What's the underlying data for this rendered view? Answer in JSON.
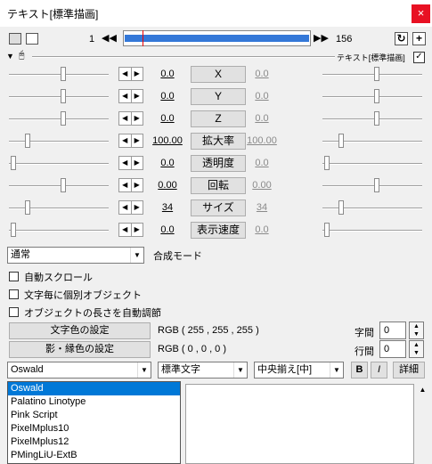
{
  "window": {
    "title": "テキスト[標準描画]",
    "close": "×"
  },
  "toolbar": {
    "frame_start": "1",
    "frame_end": "156",
    "prev_symbol": "◀◀",
    "next_symbol": "▶▶",
    "plus": "+"
  },
  "layer_header": {
    "object_name": "テキスト[標準描画]"
  },
  "params": [
    {
      "label": "X",
      "value": "0.0",
      "end_value": "0.0"
    },
    {
      "label": "Y",
      "value": "0.0",
      "end_value": "0.0"
    },
    {
      "label": "Z",
      "value": "0.0",
      "end_value": "0.0"
    },
    {
      "label": "拡大率",
      "value": "100.00",
      "end_value": "100.00"
    },
    {
      "label": "透明度",
      "value": "0.0",
      "end_value": "0.0"
    },
    {
      "label": "回転",
      "value": "0.00",
      "end_value": "0.00"
    },
    {
      "label": "サイズ",
      "value": "34",
      "end_value": "34"
    },
    {
      "label": "表示速度",
      "value": "0.0",
      "end_value": "0.0"
    }
  ],
  "blend": {
    "selected": "通常",
    "label": "合成モード"
  },
  "checkboxes": [
    {
      "label": "自動スクロール"
    },
    {
      "label": "文字毎に個別オブジェクト"
    },
    {
      "label": "オブジェクトの長さを自動調節"
    }
  ],
  "colors": {
    "text_color_button": "文字色の設定",
    "text_rgb": "RGB ( 255 , 255 , 255 )",
    "shadow_color_button": "影・縁色の設定",
    "shadow_rgb": "RGB ( 0 , 0 , 0 )",
    "accent": "#3478d8"
  },
  "spacing": {
    "char_label": "字間",
    "char_value": "0",
    "line_label": "行間",
    "line_value": "0"
  },
  "font_row": {
    "font": "Oswald",
    "style": "標準文字",
    "align": "中央揃え[中]",
    "bold": "B",
    "italic": "I",
    "detail": "詳細"
  },
  "font_list": [
    "Oswald",
    "Palatino Linotype",
    "Pink Script",
    "PixelMplus10",
    "PixelMplus12",
    "PMingLiU-ExtB"
  ]
}
